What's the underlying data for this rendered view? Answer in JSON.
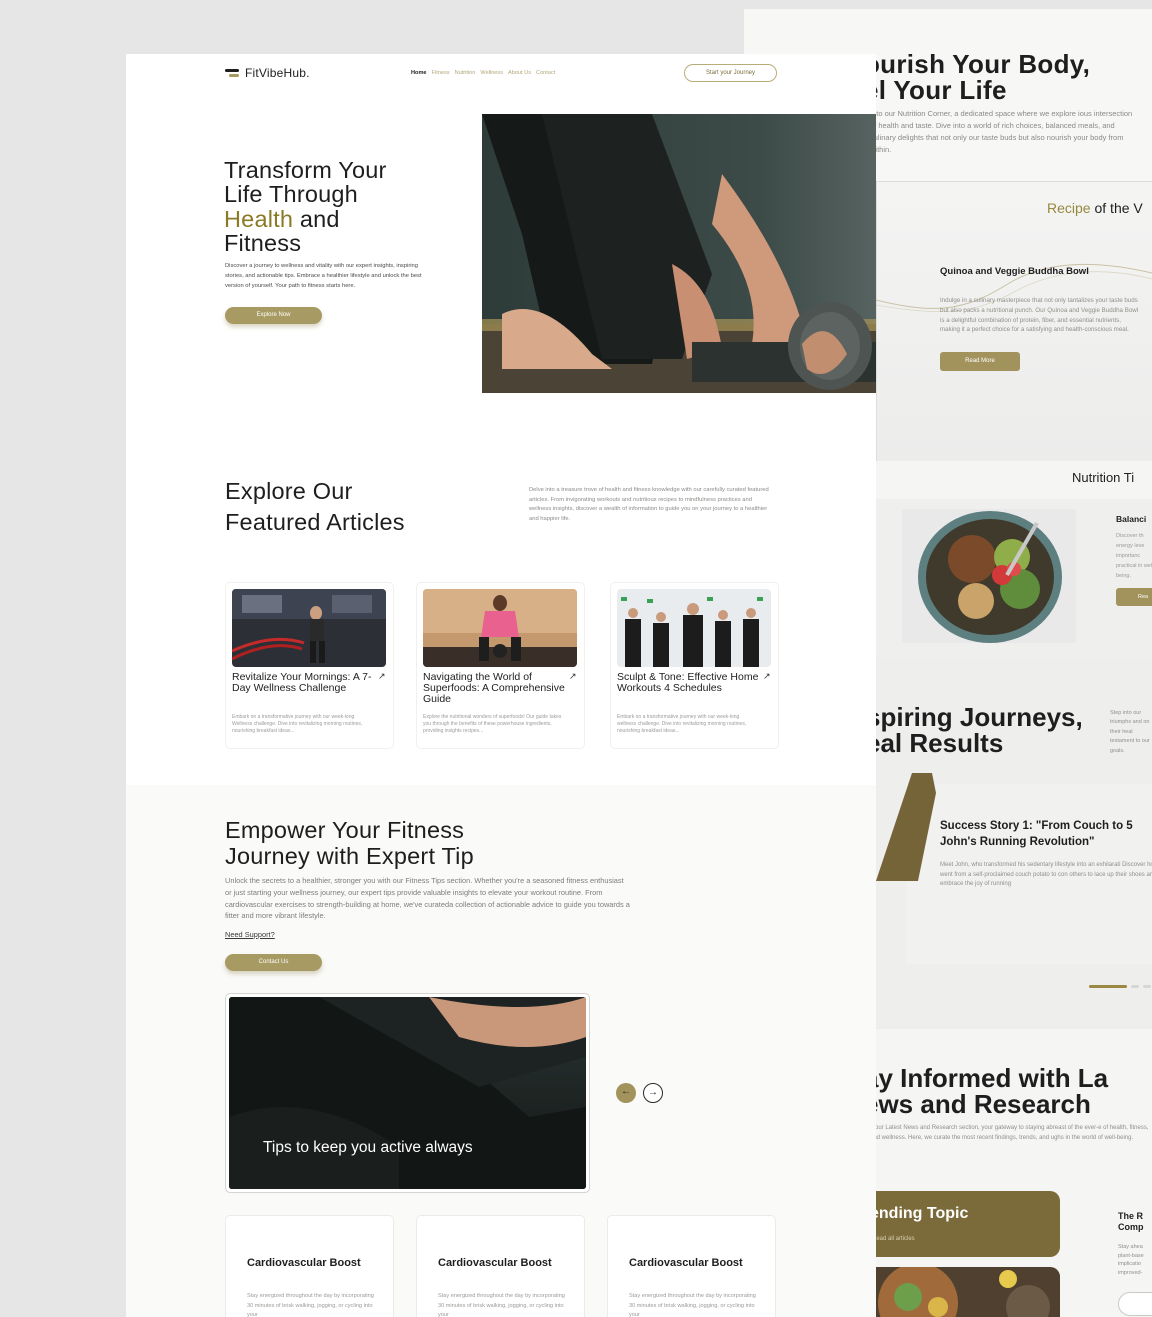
{
  "back": {
    "hero": {
      "title_line1": "ourish Your Body,",
      "title_line2": "el Your Life",
      "desc": "e to our Nutrition Corner, a dedicated space where we explore ious intersection of health and taste. Dive into a world of rich choices, balanced meals, and culinary delights that not only our taste buds but also nourish your body from within."
    },
    "recipe": {
      "heading_accent": "Recipe",
      "heading_rest": "of the V",
      "title": "Quinoa and Veggie Buddha Bowl",
      "desc": "Indulge in a culinary masterpiece that not only tantalizes your taste buds but also packs a nutritional punch. Our Quinoa and Veggie Buddha Bowl is a delightful combination of protein, fiber, and essential nutrients, making it a perfect choice for a satisfying and health-conscious meal.",
      "button": "Read More"
    },
    "nutrition_tips": {
      "heading": "Nutrition Ti",
      "label": "Balanci",
      "text": "Discover th energy leve importanc practical in well-being.",
      "button": "Rea"
    },
    "journeys": {
      "title_line1": "spiring Journeys,",
      "title_line2": "eal Results",
      "desc": "Step into our triumphs and on their heal testament to our goals.",
      "story_title": "Success Story 1: \"From Couch to 5 John's Running Revolution\"",
      "story_desc": "Meet John, who transformed his sedentary lifestyle into an exhilarati Discover how he went from a self-proclaimed couch potato to con others to lace up their shoes and embrace the joy of running"
    },
    "news": {
      "title_line1": "ay Informed with La",
      "title_line2": "ews and Research",
      "desc": "o our Latest News and Research section, your gateway to staying abreast of the ever-e of health, fitness, and wellness. Here, we curate the most recent findings, trends, and ughs in the world of well-being.",
      "trend_title": "ending Topic",
      "trend_link": "Read all articles",
      "side_title": "The R Comp",
      "side_text": "Stay ahea plant-base implicatio improved-"
    }
  },
  "front": {
    "logo": "FitVibeHub.",
    "nav": [
      "Home",
      "Fitness",
      "Nutrition",
      "Wellness",
      "About Us",
      "Contact"
    ],
    "nav_cta": "Start your Journey",
    "hero": {
      "title_line1": "Transform Your",
      "title_line2": "Life Through",
      "title_accent": "Health",
      "title_line3_rest": " and",
      "title_line4": "Fitness",
      "desc": "Discover a journey to wellness and vitality with our expert insights, inspiring stories, and actionable tips. Embrace a healthier lifestyle and unlock the best version of yourself. Your path to fitness starts here.",
      "button": "Explore Now"
    },
    "featured": {
      "title_line1": "Explore Our",
      "title_line2": "Featured Articles",
      "desc": "Delve into a treasure trove of health and fitness knowledge with our carefully curated featured articles. From invigorating workouts and nutritious recipes to mindfulness practices and wellness insights, discover a wealth of information to guide you on your journey to a healthier and happier life.",
      "articles": [
        {
          "title": "Revitalize Your Mornings: A 7-Day Wellness Challenge",
          "desc": "Embark on a transformative journey with our week-long Wellness challenge. Dive into revitalizing morning routines, nourishing breakfast ideas..."
        },
        {
          "title": "Navigating the World of Superfoods: A Comprehensive Guide",
          "desc": "Explore the nutritional wonders of superfoods! Our guide takes you through the benefits of these powerhouse ingredients, providing insights recipes..."
        },
        {
          "title": "Sculpt & Tone: Effective Home Workouts 4 Schedules",
          "desc": "Embark on a transformative journey with our week-long wellness challenge. Dive into revitalizing morning routines, nourishing breakfast ideas..."
        }
      ]
    },
    "tips": {
      "title_line1": "Empower Your Fitness",
      "title_line2": "Journey with Expert Tip",
      "desc": "Unlock the secrets to a healthier, stronger you with our Fitness Tips section. Whether you're a seasoned fitness enthusiast or just starting your wellness journey, our expert tips provide valuable insights to elevate your workout routine. From cardiovascular exercises to strength-building at home, we've curateda collection of actionable advice to guide you towards a fitter and more vibrant lifestyle.",
      "support_link": "Need Support?",
      "button": "Contact Us",
      "slide_caption": "Tips to keep you active always",
      "prev_icon": "←",
      "next_icon": "→",
      "cards": [
        {
          "title": "Cardiovascular Boost",
          "desc": "Stay energized throughout the day by incorporating 30 minutes of brisk walking, jogging, or cycling into your"
        },
        {
          "title": "Cardiovascular Boost",
          "desc": "Stay energized throughout the day by incorporating 30 minutes of brisk walking, jogging, or cycling into your"
        },
        {
          "title": "Cardiovascular Boost",
          "desc": "Stay energized throughout the day by incorporating 30 minutes of brisk walking, jogging, or cycling into your"
        }
      ]
    }
  },
  "colors": {
    "accent": "#a79a62",
    "accent_dark": "#7b6b3b",
    "accent_text": "#8a7a25"
  }
}
